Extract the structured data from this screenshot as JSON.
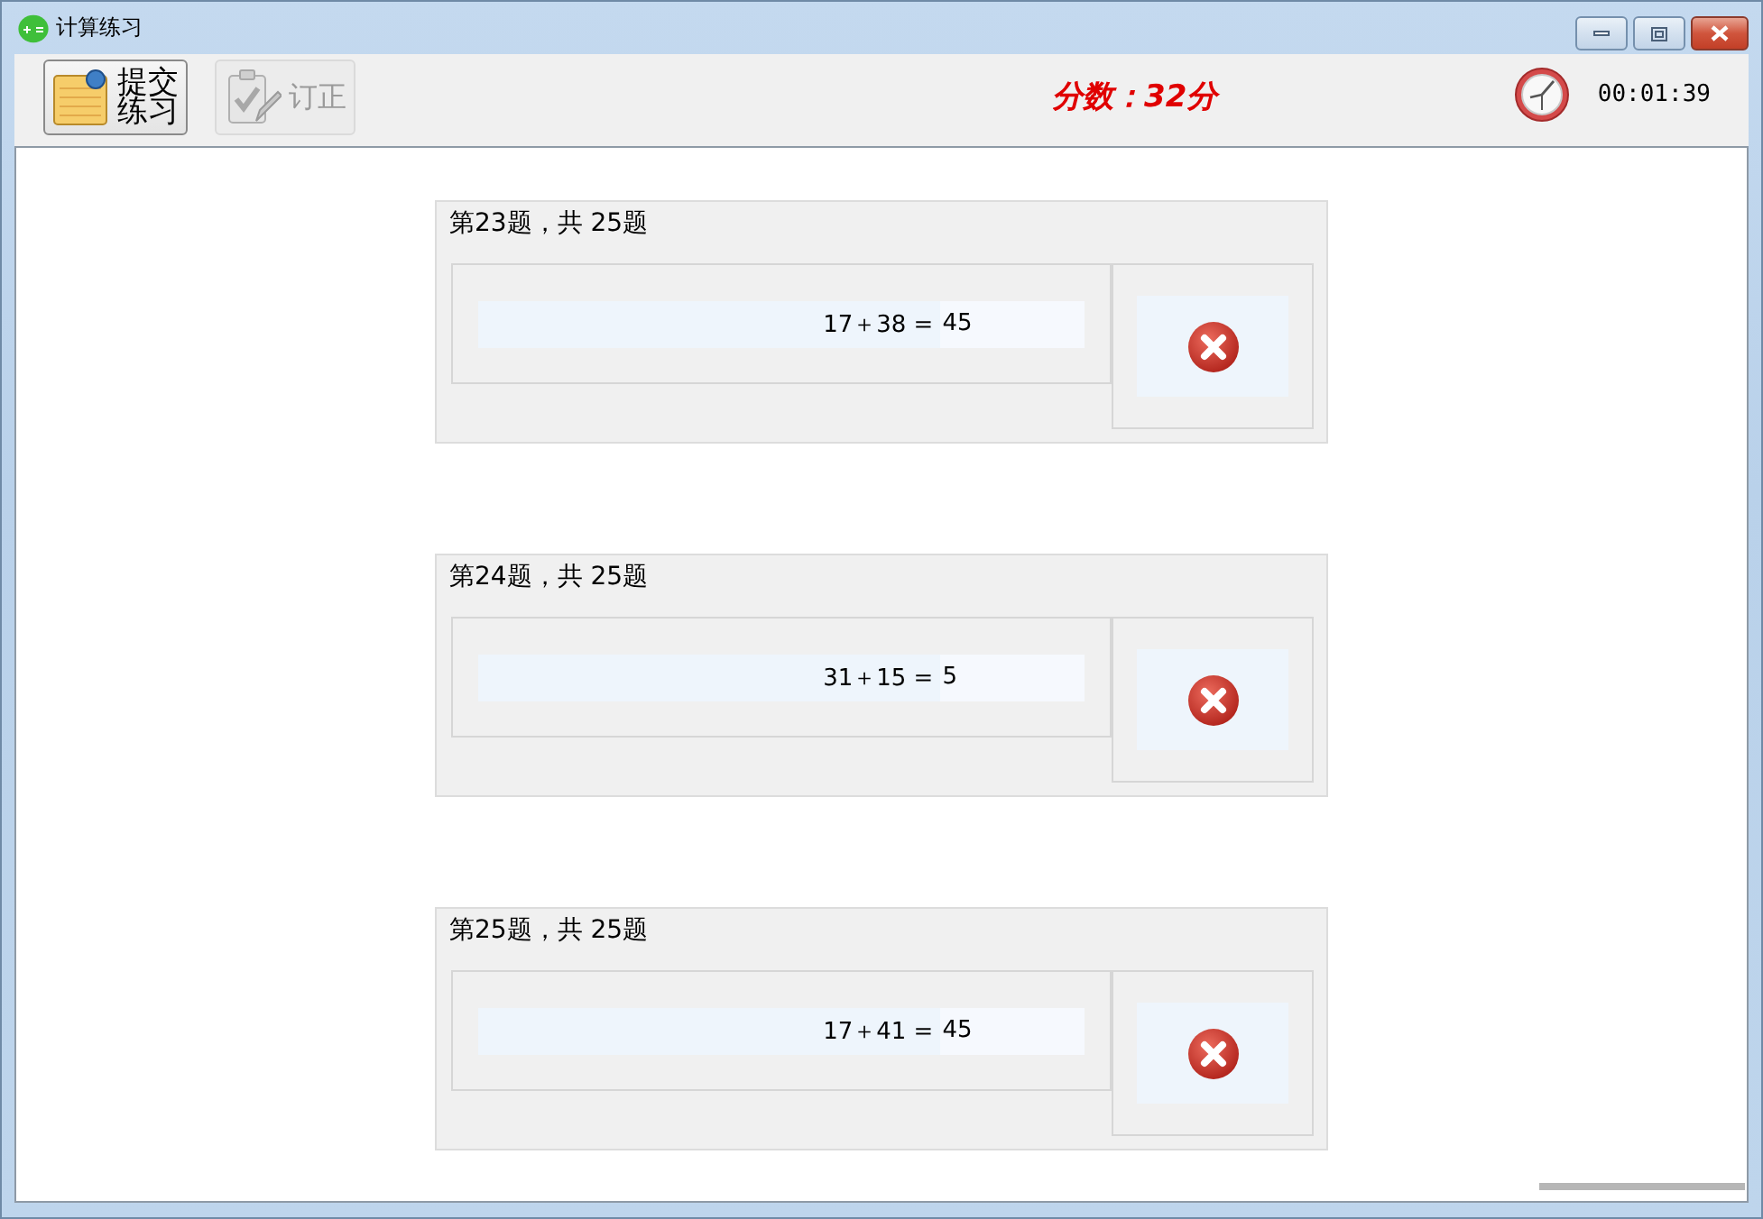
{
  "window": {
    "title": "计算练习"
  },
  "toolbar": {
    "buttons": [
      {
        "kind": "submit",
        "label": "提交练习",
        "disabled": false
      },
      {
        "kind": "correct",
        "label": "订正",
        "disabled": true
      }
    ],
    "score": "分数：32分",
    "timer": "00:01:39"
  },
  "questions": [
    {
      "heading": "第23题，共 25题",
      "expression": "17＋38 =",
      "answer": "45",
      "correct": false
    },
    {
      "heading": "第24题，共 25题",
      "expression": "31＋15 =",
      "answer": "5",
      "correct": false
    },
    {
      "heading": "第25题，共 25题",
      "expression": "17＋41 =",
      "answer": "45",
      "correct": false
    }
  ]
}
